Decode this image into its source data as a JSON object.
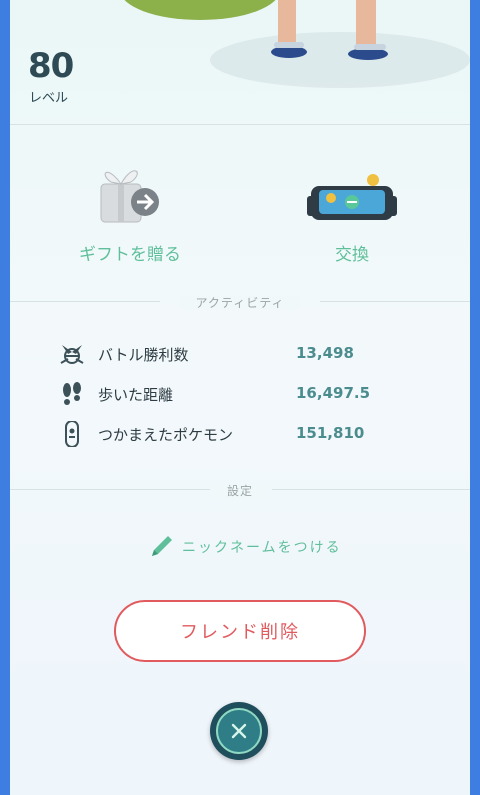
{
  "profile": {
    "level": "80",
    "level_label": "レベル"
  },
  "actions": {
    "gift_label": "ギフトを贈る",
    "trade_label": "交換"
  },
  "activity": {
    "title": "アクティビティ",
    "stats": [
      {
        "icon": "battle-icon",
        "label": "バトル勝利数",
        "value": "13,498"
      },
      {
        "icon": "footprints-icon",
        "label": "歩いた距離",
        "value": "16,497.5"
      },
      {
        "icon": "capture-icon",
        "label": "つかまえたポケモン",
        "value": "151,810"
      }
    ]
  },
  "settings": {
    "title": "設定",
    "nickname_label": "ニックネームをつける"
  },
  "remove_friend_label": "フレンド削除",
  "colors": {
    "accent": "#5fbf9a",
    "danger": "#e05a5e",
    "value": "#4b8c8e",
    "frame": "#3d7ee0"
  }
}
